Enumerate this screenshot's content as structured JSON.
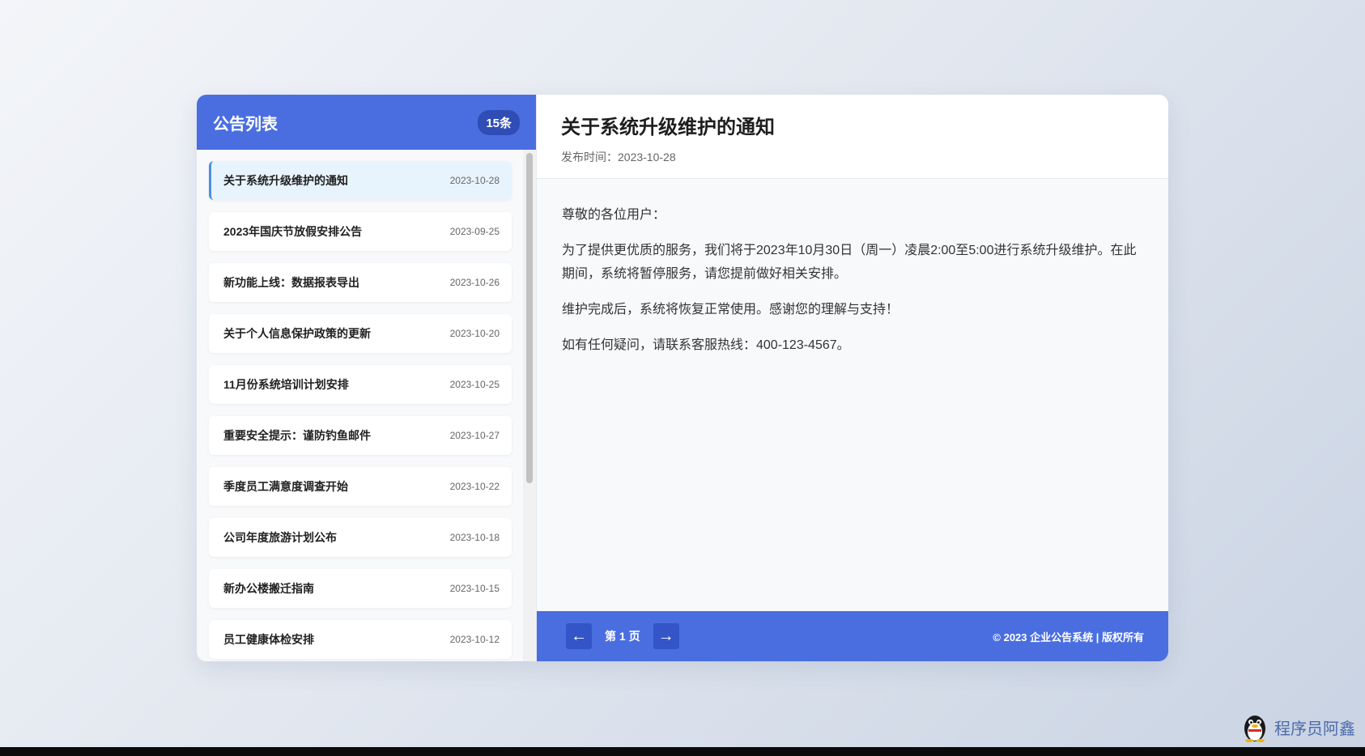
{
  "sidebar": {
    "title": "公告列表",
    "count": "15条",
    "items": [
      {
        "title": "关于系统升级维护的通知",
        "date": "2023-10-28"
      },
      {
        "title": "2023年国庆节放假安排公告",
        "date": "2023-09-25"
      },
      {
        "title": "新功能上线：数据报表导出",
        "date": "2023-10-26"
      },
      {
        "title": "关于个人信息保护政策的更新",
        "date": "2023-10-20"
      },
      {
        "title": "11月份系统培训计划安排",
        "date": "2023-10-25"
      },
      {
        "title": "重要安全提示：谨防钓鱼邮件",
        "date": "2023-10-27"
      },
      {
        "title": "季度员工满意度调查开始",
        "date": "2023-10-22"
      },
      {
        "title": "公司年度旅游计划公布",
        "date": "2023-10-18"
      },
      {
        "title": "新办公楼搬迁指南",
        "date": "2023-10-15"
      },
      {
        "title": "员工健康体检安排",
        "date": "2023-10-12"
      }
    ]
  },
  "detail": {
    "title": "关于系统升级维护的通知",
    "meta": "发布时间：2023-10-28",
    "paragraphs": [
      "尊敬的各位用户：",
      "为了提供更优质的服务，我们将于2023年10月30日（周一）凌晨2:00至5:00进行系统升级维护。在此期间，系统将暂停服务，请您提前做好相关安排。",
      "维护完成后，系统将恢复正常使用。感谢您的理解与支持！",
      "如有任何疑问，请联系客服热线：400-123-4567。"
    ]
  },
  "footer": {
    "prev": "←",
    "page_label": "第 1 页",
    "next": "→",
    "copyright": "© 2023 企业公告系统 | 版权所有"
  },
  "watermark": {
    "text": "程序员阿鑫",
    "icon": "penguin-icon"
  },
  "colors": {
    "primary": "#4a6ee0",
    "active_bg": "#e8f4fd",
    "active_border": "#4a90e2"
  }
}
